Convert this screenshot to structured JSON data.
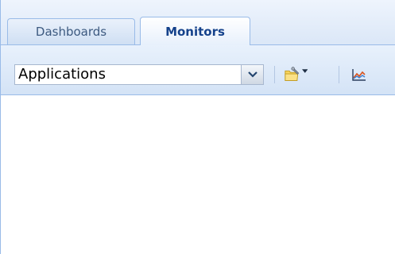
{
  "tabs": [
    {
      "label": "Dashboards",
      "active": false
    },
    {
      "label": "Monitors",
      "active": true
    }
  ],
  "toolbar": {
    "selector_value": "Applications",
    "icons": [
      "chevron-down-icon",
      "folder-settings-icon",
      "dropdown-arrow-icon",
      "line-chart-icon"
    ]
  },
  "colors": {
    "border": "#99bbe8",
    "active_tab_text": "#15428b",
    "inactive_tab_text": "#3d5a80",
    "toolbar_bg": "#d4e3f6"
  }
}
